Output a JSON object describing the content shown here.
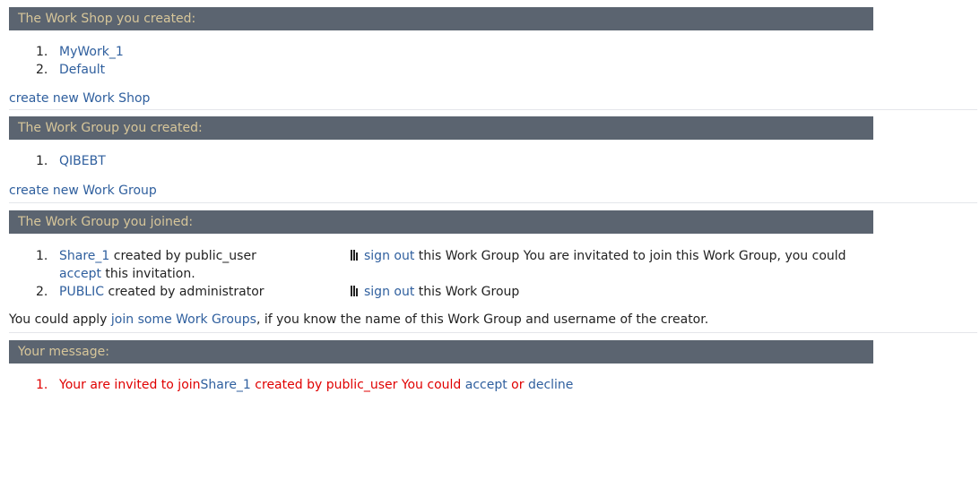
{
  "workshops": {
    "header": "The Work Shop you created:",
    "items": [
      {
        "num": "1.",
        "name": "MyWork_1"
      },
      {
        "num": "2.",
        "name": "Default"
      }
    ],
    "create_link": "create new Work Shop"
  },
  "workgroups_created": {
    "header": "The Work Group you created:",
    "items": [
      {
        "num": "1.",
        "name": "QIBEBT"
      }
    ],
    "create_link": "create new Work Group"
  },
  "workgroups_joined": {
    "header": "The Work Group you joined:",
    "items": [
      {
        "num": "1.",
        "name": "Share_1",
        "created_by": " created by public_user",
        "signout_link": "sign out",
        "signout_suffix": " this Work Group You are invitated to join this Work Group, you could",
        "accept_link": "accept",
        "accept_suffix": " this invitation."
      },
      {
        "num": "2.",
        "name": "PUBLIC",
        "created_by": " created by administrator",
        "signout_link": "sign out",
        "signout_suffix": " this Work Group"
      }
    ],
    "hint_prefix": "You could apply ",
    "hint_link": "join some Work Groups",
    "hint_suffix": ", if you know the name of this Work Group and username of the creator."
  },
  "messages": {
    "header": "Your message:",
    "items": [
      {
        "num": "1.",
        "prefix": "Your are invited to join",
        "group_link": "Share_1",
        "middle": " created by public_user You could ",
        "accept_link": "accept",
        "or_text": " or ",
        "decline_link": "decline"
      }
    ]
  },
  "icons": {
    "signout_icon": "bars-icon"
  },
  "colors": {
    "header_bg": "#5b6470",
    "header_text": "#d7c69a",
    "link": "#2f5f9e",
    "message_text": "#e00000"
  }
}
